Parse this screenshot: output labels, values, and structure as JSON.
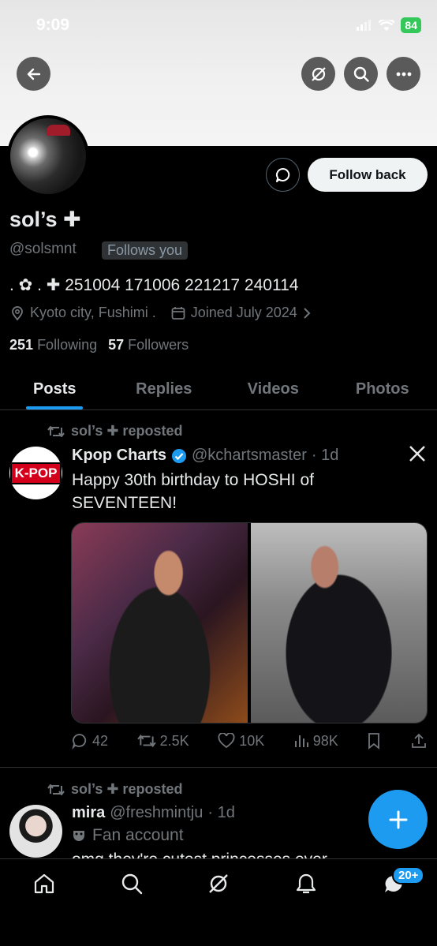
{
  "status_bar": {
    "time": "9:09",
    "battery": "84"
  },
  "profile": {
    "name": "sol’s ✚",
    "handle": "@solsmnt",
    "follows_you": "Follows you",
    "bio": ". ✿ . ✚ 251004 171006 221217 240114",
    "location": "Kyoto  city,  Fushimi  .",
    "joined": "Joined July 2024",
    "following_count": "251",
    "following_label": "Following",
    "followers_count": "57",
    "followers_label": "Followers",
    "follow_button": "Follow back"
  },
  "tabs": [
    {
      "label": "Posts",
      "active": true
    },
    {
      "label": "Replies",
      "active": false
    },
    {
      "label": "Videos",
      "active": false
    },
    {
      "label": "Photos",
      "active": false
    }
  ],
  "posts": [
    {
      "repost_label": "sol’s ✚ reposted",
      "avatar_text": "K-POP",
      "name": "Kpop Charts",
      "handle": "@kchartsmaster",
      "time": "· 1d",
      "text": "Happy 30th birthday to HOSHI of SEVENTEEN!",
      "replies": "42",
      "reposts": "2.5K",
      "likes": "10K",
      "views": "98K"
    },
    {
      "repost_label": "sol’s ✚ reposted",
      "name": "mira",
      "handle": "@freshmintju",
      "time": "· 1d",
      "label": "Fan account",
      "text": "omg they're cutest princesses ever"
    }
  ],
  "nav": {
    "badge": "20+"
  },
  "colors": {
    "accent": "#1d9bf0",
    "battery": "#34c759",
    "background": "#000000"
  }
}
